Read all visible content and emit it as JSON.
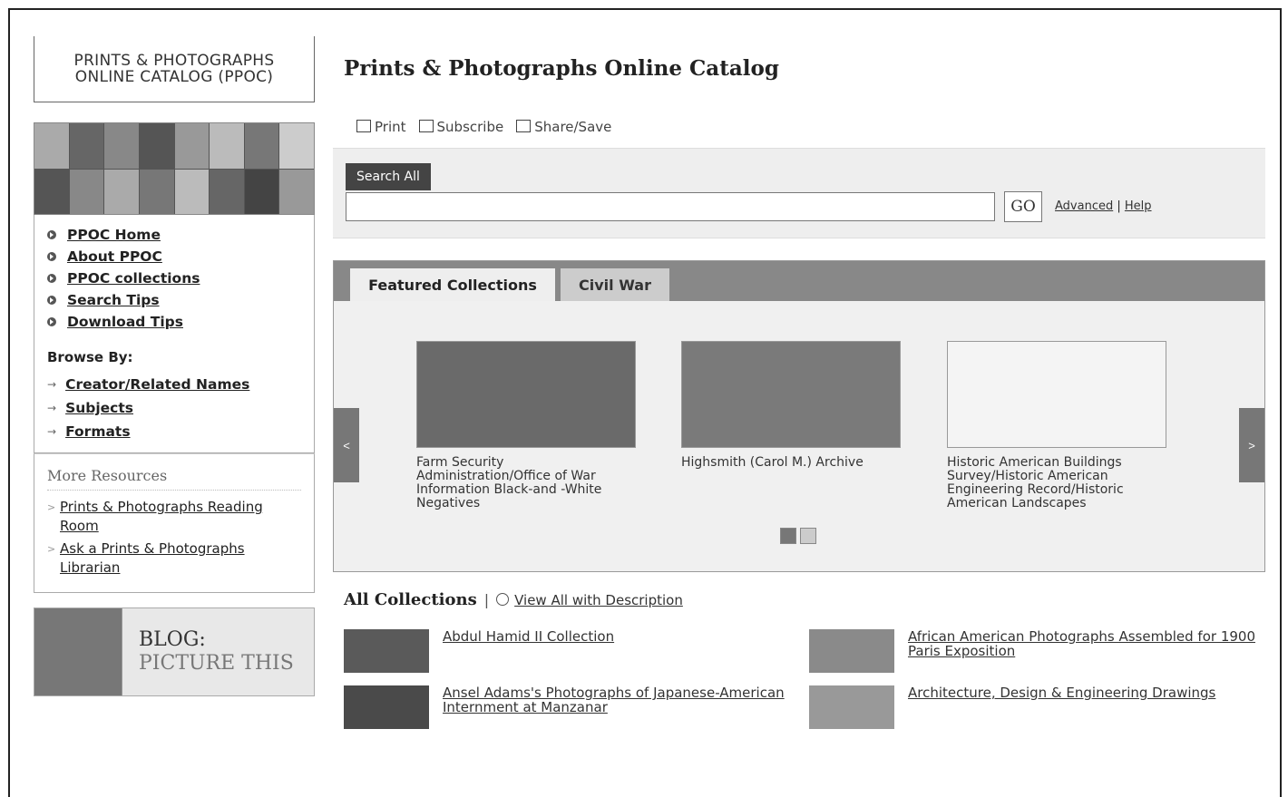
{
  "sidebar": {
    "ppoc_title_line1": "PRINTS & PHOTOGRAPHS",
    "ppoc_title_line2": "ONLINE CATALOG (PPOC)",
    "nav": [
      {
        "label": "PPOC Home"
      },
      {
        "label": "About PPOC"
      },
      {
        "label": "PPOC collections"
      },
      {
        "label": "Search Tips"
      },
      {
        "label": "Download Tips"
      }
    ],
    "browse_heading": "Browse By:",
    "browse": [
      {
        "label": "Creator/Related Names"
      },
      {
        "label": "Subjects"
      },
      {
        "label": "Formats"
      }
    ],
    "more_heading": "More Resources",
    "more": [
      {
        "label": "Prints & Photographs Reading Room"
      },
      {
        "label": "Ask a Prints & Photographs Librarian"
      }
    ],
    "blog_line1": "BLOG:",
    "blog_line2": "PICTURE THIS"
  },
  "main": {
    "title": "Prints & Photographs Online Catalog",
    "tools": {
      "print": "Print",
      "subscribe": "Subscribe",
      "share": "Share/Save"
    },
    "search": {
      "tab_label": "Search All",
      "value": "",
      "go_label": "GO",
      "advanced": "Advanced",
      "separator": "|",
      "help": "Help"
    },
    "featured": {
      "tabs": [
        "Featured Collections",
        "Civil War"
      ],
      "prev": "<",
      "next": ">",
      "slides": [
        {
          "caption": "Farm Security Administration/Office of War Information Black-and -White Negatives"
        },
        {
          "caption": "Highsmith (Carol M.) Archive"
        },
        {
          "caption": "Historic American Buildings Survey/Historic American Engineering Record/Historic American Landscapes"
        }
      ],
      "active_page": 1,
      "page_count": 2
    },
    "all_collections": {
      "heading": "All Collections",
      "separator": "|",
      "view_all": "View All with Description",
      "items": [
        {
          "name": "Abdul Hamid II Collection"
        },
        {
          "name": "African American Photographs Assembled for 1900 Paris Exposition"
        },
        {
          "name": "Ansel Adams's Photographs of Japanese-American Internment at Manzanar"
        },
        {
          "name": "Architecture, Design & Engineering Drawings"
        }
      ]
    }
  }
}
